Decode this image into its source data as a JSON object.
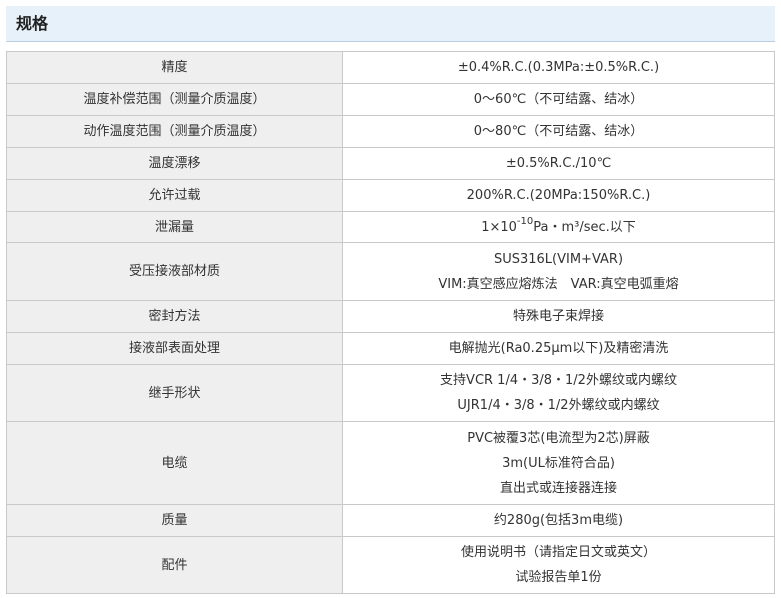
{
  "section": {
    "title": "规格"
  },
  "rows": [
    {
      "label": "精度",
      "lines": [
        "±0.4%R.C.(0.3MPa:±0.5%R.C.)"
      ]
    },
    {
      "label": "温度补偿范围（测量介质温度）",
      "lines": [
        "0～60℃（不可结露、结冰）"
      ]
    },
    {
      "label": "动作温度范围（测量介质温度）",
      "lines": [
        "0～80℃（不可结露、结冰）"
      ]
    },
    {
      "label": "温度漂移",
      "lines": [
        "±0.5%R.C./10℃"
      ]
    },
    {
      "label": "允许过载",
      "lines": [
        "200%R.C.(20MPa:150%R.C.)"
      ]
    },
    {
      "label": "泄漏量",
      "leak": {
        "prefix": "1×10",
        "exponent": "-10",
        "suffix": "Pa・m³/sec.以下"
      }
    },
    {
      "label": "受压接液部材质",
      "lines": [
        "SUS316L(VIM+VAR)",
        "VIM:真空感应熔炼法　VAR:真空电弧重熔"
      ]
    },
    {
      "label": "密封方法",
      "lines": [
        "特殊电子束焊接"
      ]
    },
    {
      "label": "接液部表面处理",
      "lines": [
        "电解抛光(Ra0.25μm以下)及精密清洗"
      ]
    },
    {
      "label": "继手形状",
      "lines": [
        "支持VCR 1/4・3/8・1/2外螺纹或内螺纹",
        "UJR1/4・3/8・1/2外螺纹或内螺纹"
      ]
    },
    {
      "label": "电缆",
      "lines": [
        "PVC被覆3芯(电流型为2芯)屏蔽",
        "3m(UL标准符合品)",
        "直出式或连接器连接"
      ]
    },
    {
      "label": "质量",
      "lines": [
        "约280g(包括3m电缆)"
      ]
    },
    {
      "label": "配件",
      "lines": [
        "使用说明书（请指定日文或英文）",
        "试验报告单1份"
      ]
    }
  ]
}
